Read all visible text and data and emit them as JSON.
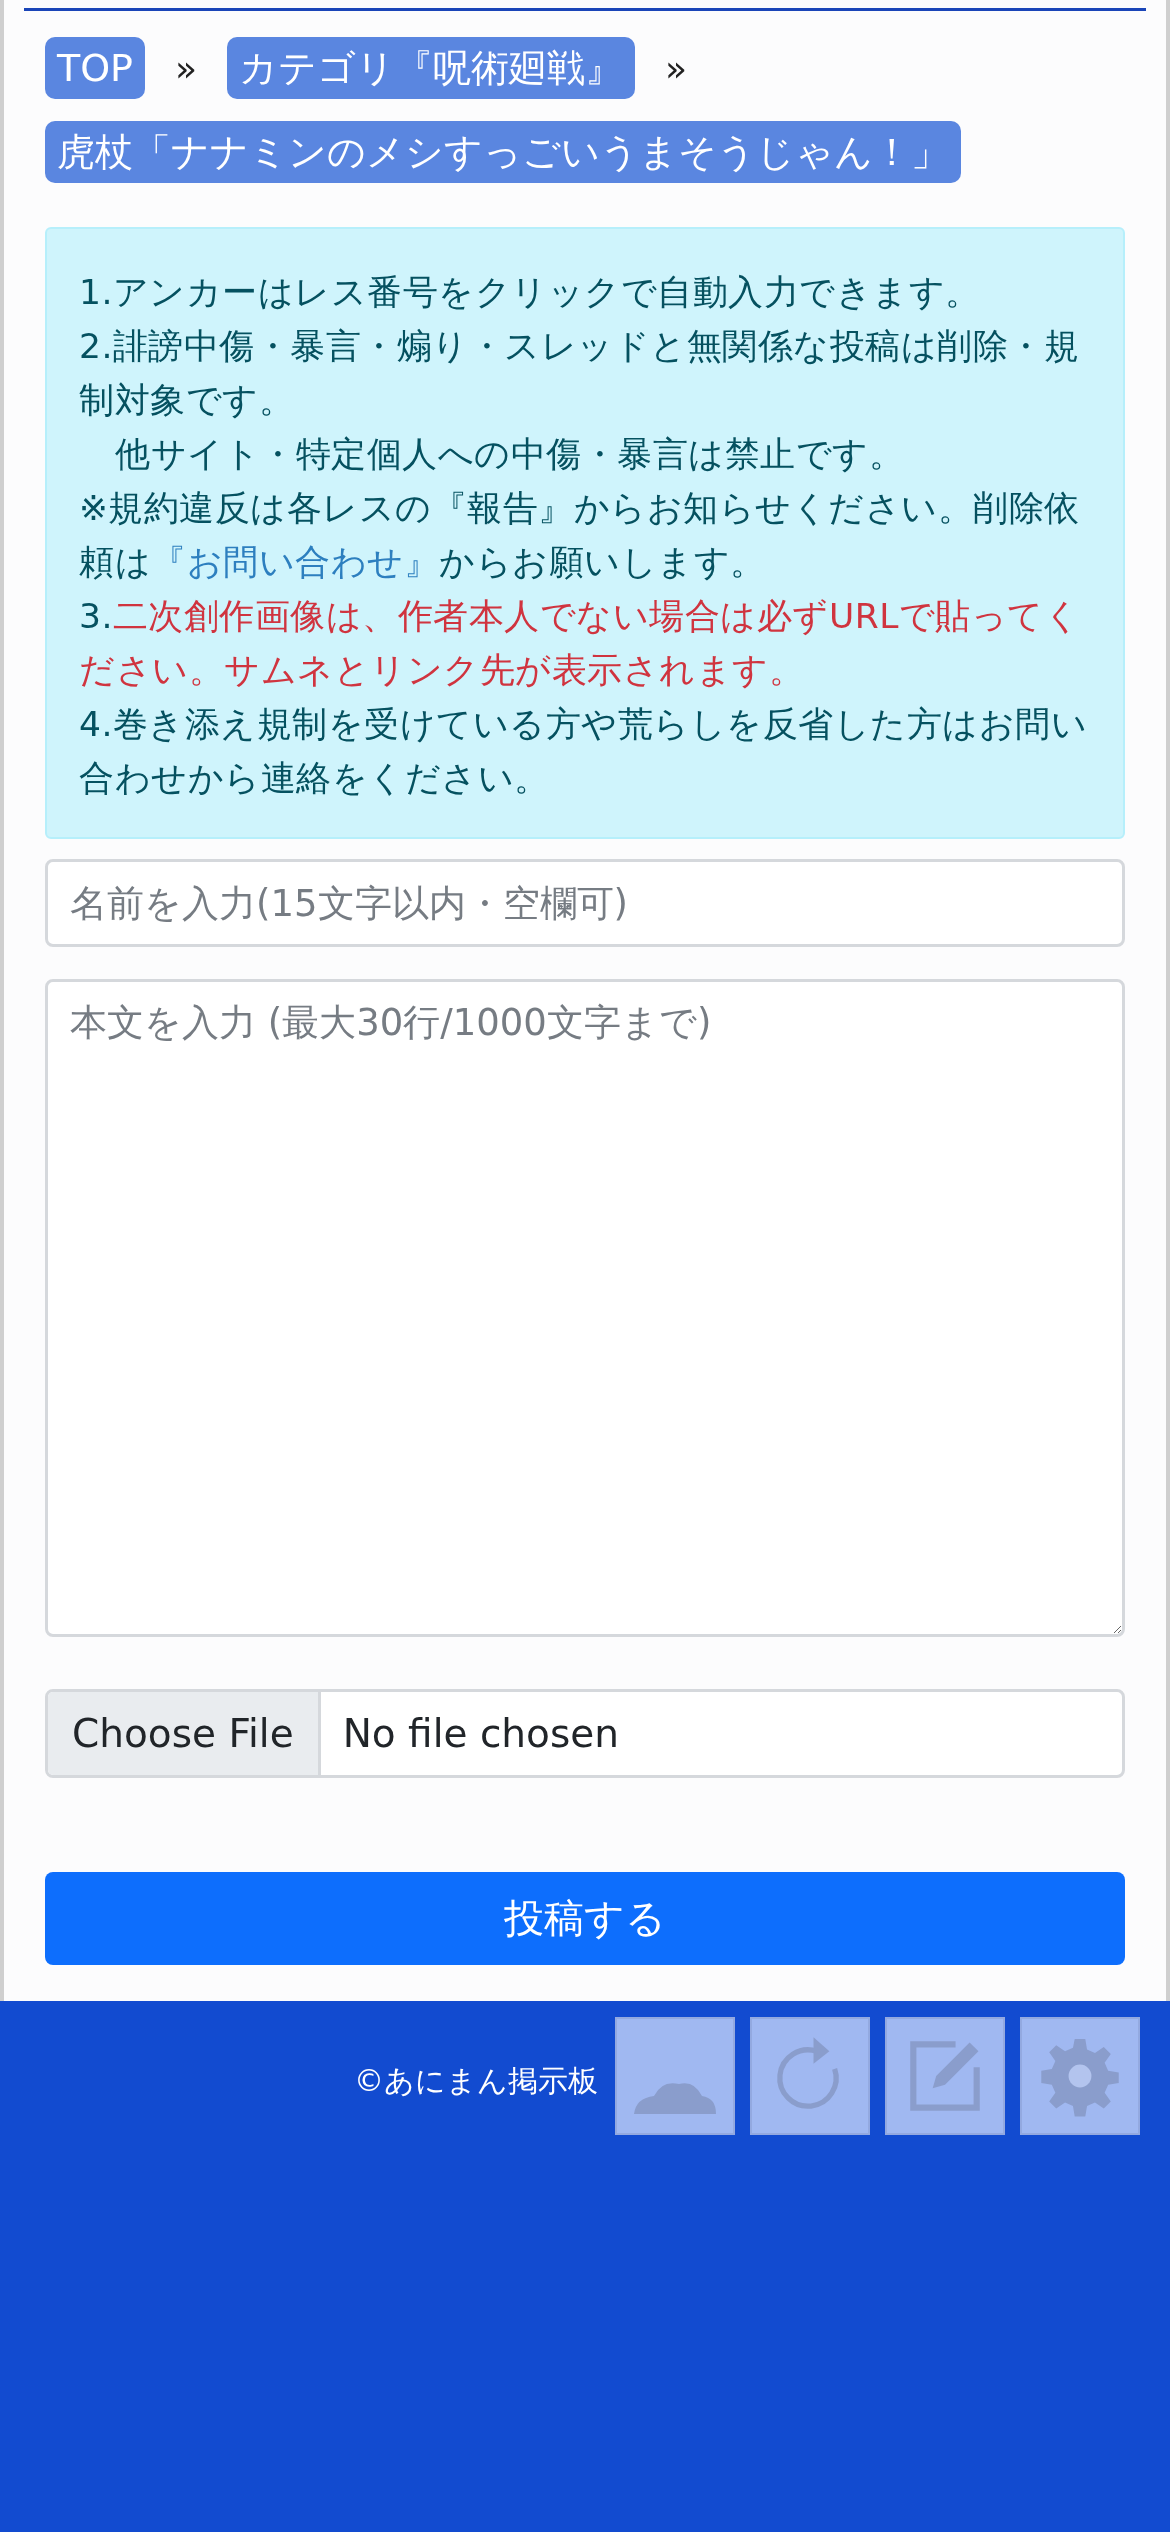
{
  "breadcrumbs": [
    {
      "kind": "crumb",
      "label": "TOP"
    },
    {
      "kind": "separator",
      "label": "»"
    },
    {
      "kind": "crumb",
      "label": "カテゴリ『呪術廻戦』"
    },
    {
      "kind": "separator",
      "label": "»"
    },
    {
      "kind": "crumb",
      "label": "虎杖「ナナミンのメシすっごいうまそうじゃん！」"
    }
  ],
  "notice": [
    {
      "indent": false,
      "segments": [
        {
          "kind": "plain",
          "text": "1.アンカーはレス番号をクリックで自動入力できます。"
        }
      ]
    },
    {
      "indent": false,
      "segments": [
        {
          "kind": "plain",
          "text": "2.誹謗中傷・暴言・煽り・スレッドと無関係な投稿は削除・規制対象です。"
        }
      ]
    },
    {
      "indent": true,
      "segments": [
        {
          "kind": "plain",
          "text": "他サイト・特定個人への中傷・暴言は禁止です。"
        }
      ]
    },
    {
      "indent": false,
      "segments": [
        {
          "kind": "plain",
          "text": "※規約違反は各レスの『報告』からお知らせください。削除依頼は"
        },
        {
          "kind": "link",
          "text": "『お問い合わせ』"
        },
        {
          "kind": "plain",
          "text": "からお願いします。"
        }
      ]
    },
    {
      "indent": false,
      "segments": [
        {
          "kind": "plain",
          "text": "3."
        },
        {
          "kind": "warning",
          "text": "二次創作画像は、作者本人でない場合は必ずURLで貼ってください。サムネとリンク先が表示されます。"
        }
      ]
    },
    {
      "indent": false,
      "segments": [
        {
          "kind": "plain",
          "text": "4.巻き添え規制を受けている方や荒らしを反省した方はお問い合わせから連絡をください。"
        }
      ]
    }
  ],
  "form": {
    "name": {
      "placeholder": "名前を入力(15文字以内・空欄可)"
    },
    "body": {
      "placeholder": "本文を入力 (最大30行/1000文字まで)"
    },
    "file": {
      "button": "Choose File",
      "status": "No file chosen"
    },
    "submit": "投稿する"
  },
  "footer": {
    "copyright": "©あにまん掲示板"
  },
  "float_buttons": [
    {
      "kind": "cloud"
    },
    {
      "kind": "reload"
    },
    {
      "kind": "edit"
    },
    {
      "kind": "settings"
    }
  ]
}
